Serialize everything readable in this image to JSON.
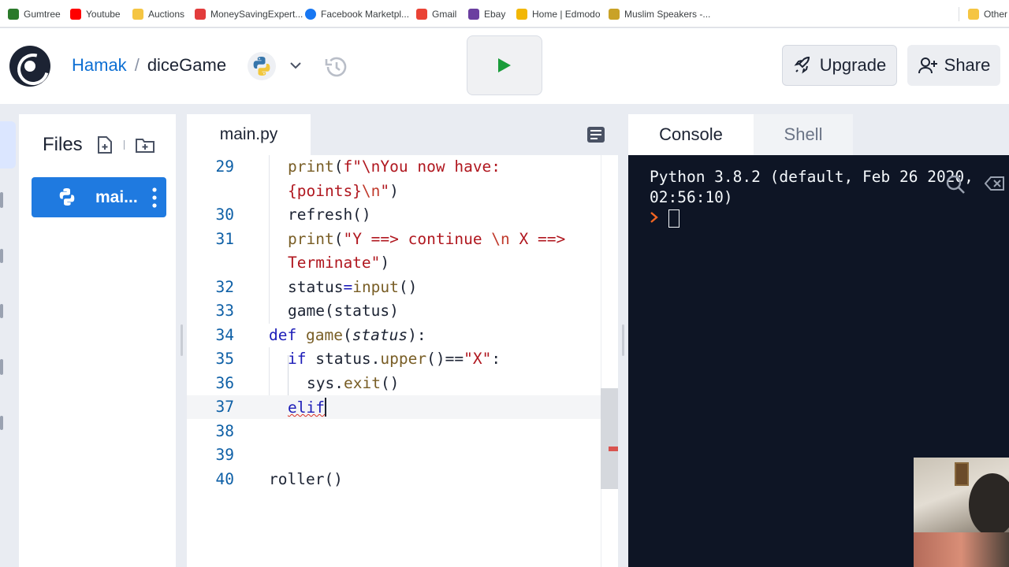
{
  "bookmarks": [
    {
      "label": "Gumtree",
      "color": "#2b7a2b"
    },
    {
      "label": "Youtube",
      "color": "#ff0000"
    },
    {
      "label": "Auctions",
      "color": "#f5c542"
    },
    {
      "label": "MoneySavingExpert...",
      "color": "#e23c3c"
    },
    {
      "label": "Facebook Marketpl...",
      "color": "#1877f2"
    },
    {
      "label": "Gmail",
      "color": "#ea4335"
    },
    {
      "label": "Ebay",
      "color": "#6b3fa0"
    },
    {
      "label": "Home | Edmodo",
      "color": "#f2b705"
    },
    {
      "label": "Muslim Speakers -...",
      "color": "#c9a227"
    },
    {
      "label": "Other",
      "color": "#f5c542"
    }
  ],
  "header": {
    "user": "Hamak",
    "separator": "/",
    "project": "diceGame",
    "language_icon": "python-icon",
    "upgrade_label": "Upgrade",
    "share_label": "Share",
    "run_color": "#1a9c3a"
  },
  "files": {
    "title": "Files",
    "items": [
      {
        "label": "mai...",
        "icon": "python-icon"
      }
    ]
  },
  "editor": {
    "tab": "main.py",
    "lines": [
      {
        "n": "29",
        "tokens": [
          [
            "fn",
            "print"
          ],
          [
            "",
            "("
          ],
          [
            "st",
            "f\"\\nYou now have:"
          ]
        ]
      },
      {
        "n": "",
        "tokens": [
          [
            "st",
            "{points}"
          ],
          [
            "es",
            "\\n"
          ],
          [
            "st",
            "\""
          ],
          [
            "",
            ")"
          ]
        ]
      },
      {
        "n": "30",
        "tokens": [
          [
            "",
            "refresh()"
          ]
        ]
      },
      {
        "n": "31",
        "tokens": [
          [
            "fn",
            "print"
          ],
          [
            "",
            "("
          ],
          [
            "st",
            "\"Y ==> continue "
          ],
          [
            "es",
            "\\n"
          ],
          [
            "st",
            " X ==>"
          ]
        ]
      },
      {
        "n": "",
        "tokens": [
          [
            "st",
            "Terminate\""
          ],
          [
            "",
            ")"
          ]
        ]
      },
      {
        "n": "32",
        "tokens": [
          [
            "",
            "status"
          ],
          [
            "kw",
            "="
          ],
          [
            "fn",
            "input"
          ],
          [
            "",
            "()"
          ]
        ]
      },
      {
        "n": "33",
        "tokens": [
          [
            "",
            "game(status)"
          ]
        ]
      },
      {
        "n": "34",
        "tokens": [
          [
            "kw",
            "def "
          ],
          [
            "fn",
            "game"
          ],
          [
            "",
            "("
          ],
          [
            "it",
            "status"
          ],
          [
            "",
            "):"
          ]
        ]
      },
      {
        "n": "35",
        "tokens": [
          [
            "kw",
            "if "
          ],
          [
            "",
            "status."
          ],
          [
            "fn",
            "upper"
          ],
          [
            "",
            "()=="
          ],
          [
            "st",
            "\"X\""
          ],
          [
            "",
            ":"
          ]
        ]
      },
      {
        "n": "36",
        "tokens": [
          [
            "",
            "sys."
          ],
          [
            "fn",
            "exit"
          ],
          [
            "",
            "()"
          ]
        ]
      },
      {
        "n": "37",
        "tokens": [
          [
            "err",
            "elif"
          ]
        ]
      },
      {
        "n": "38",
        "tokens": []
      },
      {
        "n": "39",
        "tokens": []
      },
      {
        "n": "40",
        "tokens": [
          [
            "",
            "roller()"
          ]
        ]
      }
    ]
  },
  "console": {
    "tabs": [
      "Console",
      "Shell"
    ],
    "lines": [
      "Python 3.8.2 (default, Feb 26 2020,",
      "02:56:10)"
    ],
    "prompt_color": "#f26522"
  }
}
